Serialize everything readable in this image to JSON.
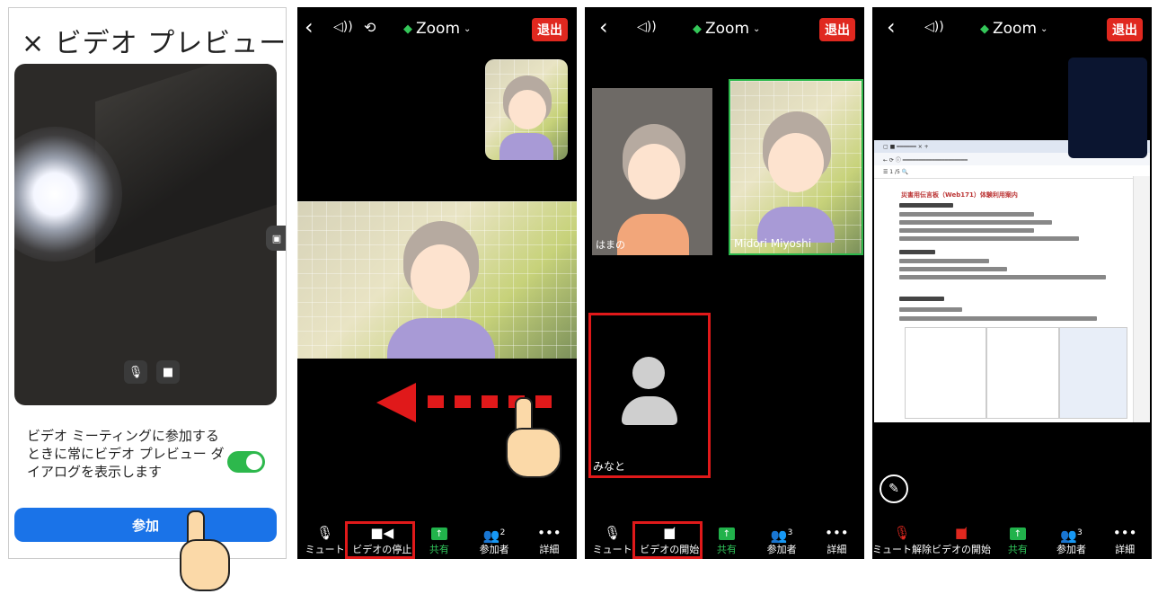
{
  "panel1": {
    "close_icon": "close-icon",
    "title": "ビデオ プレビュー",
    "preview_text": "ビデオ ミーティングに参加するときに常にビデオ プレビュー ダイアログを表示します",
    "toggle_on": true,
    "join_label": "参加"
  },
  "meeting": {
    "title": "Zoom",
    "leave_label": "退出"
  },
  "panel2": {
    "toolbar": [
      {
        "label": "ミュート",
        "icon": "mic-icon"
      },
      {
        "label": "ビデオの停止",
        "icon": "video-icon"
      },
      {
        "label": "共有",
        "icon": "share-icon"
      },
      {
        "label": "参加者",
        "icon": "participants-icon",
        "count": "2"
      },
      {
        "label": "詳細",
        "icon": "more-icon"
      }
    ]
  },
  "panel3": {
    "participants": [
      "はまの",
      "Midori Miyoshi",
      "みなと"
    ],
    "toolbar": [
      {
        "label": "ミュート",
        "icon": "mic-icon"
      },
      {
        "label": "ビデオの開始",
        "icon": "video-off-icon"
      },
      {
        "label": "共有",
        "icon": "share-icon"
      },
      {
        "label": "参加者",
        "icon": "participants-icon",
        "count": "3"
      },
      {
        "label": "詳細",
        "icon": "more-icon"
      }
    ]
  },
  "panel4": {
    "doc_heading": "災害用伝言板（Web171）体験利用案内",
    "toolbar": [
      {
        "label": "ミュート解除",
        "icon": "mic-off-icon"
      },
      {
        "label": "ビデオの開始",
        "icon": "video-off-icon"
      },
      {
        "label": "共有",
        "icon": "share-icon"
      },
      {
        "label": "参加者",
        "icon": "participants-icon",
        "count": "3"
      },
      {
        "label": "詳細",
        "icon": "more-icon"
      }
    ]
  },
  "colors": {
    "leave": "#e0281f",
    "join": "#1a73e8",
    "highlight": "#e0191a",
    "share": "#21b24b"
  }
}
